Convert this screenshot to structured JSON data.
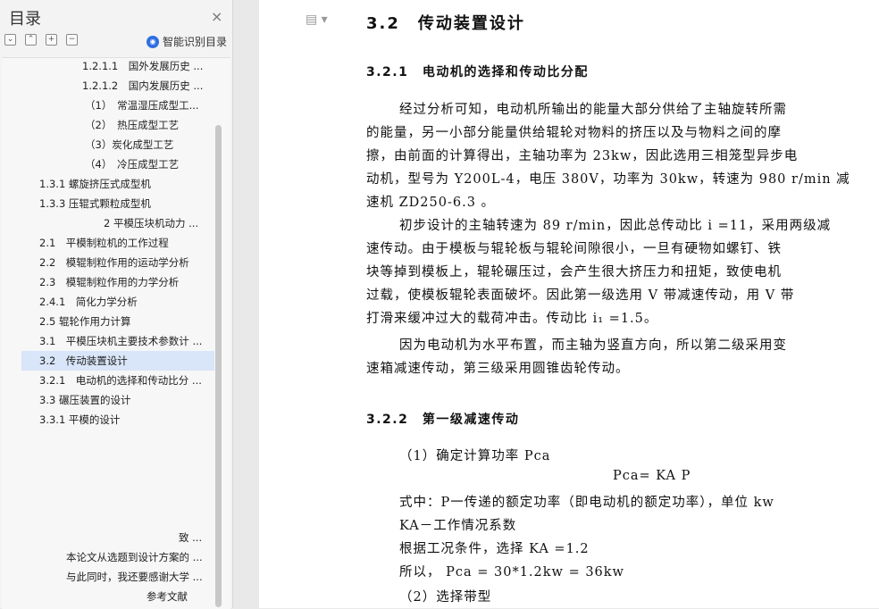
{
  "sidebar": {
    "title": "目录",
    "close_icon": "×",
    "tools": [
      "⌄",
      "⌃",
      "+",
      "−"
    ],
    "smart_label": "智能识别目录",
    "items": [
      {
        "label": "1.2.1.1　国外发展历史 ..."
      },
      {
        "label": "1.2.1.2　国内发展历史 ..."
      },
      {
        "label": "（1）　常温湿压成型工..."
      },
      {
        "label": "（2）　热压成型工艺"
      },
      {
        "label": "（3）炭化成型工艺"
      },
      {
        "label": "（4）　冷压成型工艺"
      },
      {
        "label": "1.3.1  螺旋挤压式成型机"
      },
      {
        "label": "1.3.3  压辊式颗粒成型机"
      },
      {
        "label": "2 平模压块机动力 ..."
      },
      {
        "label": "2.1　平模制粒机的工作过程"
      },
      {
        "label": "2.2　模辊制粒作用的运动学分析"
      },
      {
        "label": "2.3　模辊制粒作用的力学分析"
      },
      {
        "label": "2.4.1　简化力学分析"
      },
      {
        "label": "2.5  辊轮作用力计算"
      },
      {
        "label": "3.1　平模压块机主要技术参数计 ..."
      },
      {
        "label": "3.2　传动装置设计"
      },
      {
        "label": "3.2.1　电动机的选择和传动比分 ..."
      },
      {
        "label": "3.3 碾压装置的设计"
      },
      {
        "label": "3.3.1 平模的设计"
      },
      {
        "label": "致 ..."
      },
      {
        "label": "本论文从选题到设计方案的 ..."
      },
      {
        "label": "与此同时，我还要感谢大学 ..."
      },
      {
        "label": "参考文献"
      }
    ]
  },
  "document": {
    "heading_1": "3.2　传动装置设计",
    "heading_2a": "3.2.1　电动机的选择和传动比分配",
    "para1": [
      "经过分析可知，电动机所输出的能量大部分供给了主轴旋转所需",
      "的能量，另一小部分能量供给辊轮对物料的挤压以及与物料之间的摩",
      "擦，由前面的计算得出，主轴功率为 23kw，因此选用三相笼型异步电",
      "动机，型号为 Y200L-4，电压 380V，功率为 30kw，转速为 980 r/min 减",
      "速机 ZD250-6.3 。"
    ],
    "para2": [
      "初步设计的主轴转速为 89 r/min，因此总传动比 i =11，采用两级减",
      "速传动。由于模板与辊轮板与辊轮间隙很小，一旦有硬物如螺钉、铁",
      "块等掉到模板上，辊轮碾压过，会产生很大挤压力和扭矩，致使电机",
      "过载，使模板辊轮表面破坏。因此第一级选用 V 带减速传动，用 V 带",
      "打滑来缓冲过大的载荷冲击。传动比 i₁ =1.5。"
    ],
    "para3": [
      "因为电动机为水平布置，而主轴为竖直方向，所以第二级采用变",
      "速箱减速传动，第三级采用圆锥齿轮传动。"
    ],
    "heading_2b": "3.2.2　第一级减速传动",
    "calc": [
      "（1）确定计算功率 Pca",
      "Pca= KA P",
      "式中：P一传递的额定功率（即电动机的额定功率），单位 kw",
      "KA－工作情况系数",
      "根据工况条件，选择 KA =1.2",
      "所以，  Pca = 30*1.2kw = 36kw",
      "（2）选择带型"
    ]
  }
}
